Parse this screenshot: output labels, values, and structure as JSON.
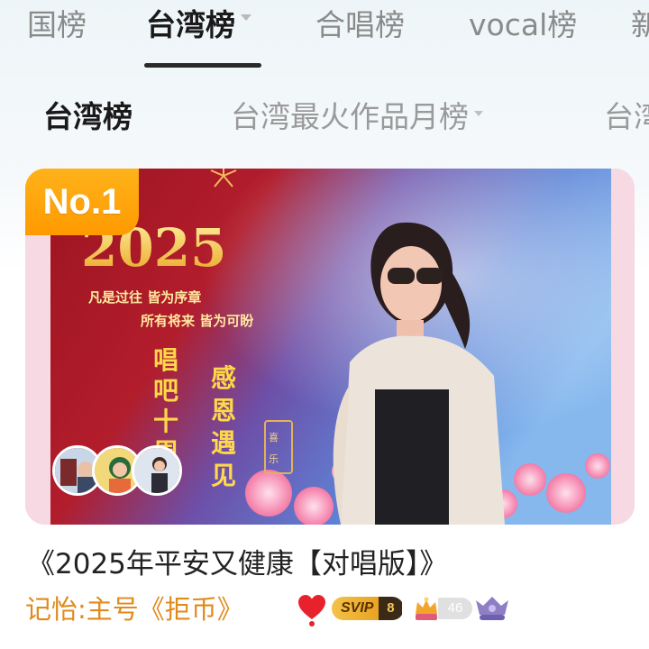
{
  "top_tabs": [
    {
      "label": "国榜"
    },
    {
      "label": "台湾榜",
      "active": true
    },
    {
      "label": "合唱榜"
    },
    {
      "label": "vocal榜"
    },
    {
      "label": "新"
    }
  ],
  "sub_tabs": [
    {
      "label": "台湾榜",
      "active": true
    },
    {
      "label": "台湾最火作品月榜"
    },
    {
      "label": "台湾"
    }
  ],
  "card": {
    "rank": "No.1",
    "cover_texts": {
      "year": "2025",
      "line1": "凡是过往 皆为序章",
      "line2": "所有将来 皆为可盼",
      "vertical_left": "唱吧十周",
      "vertical_right": "感恩遇见",
      "small_box": "喜乐"
    },
    "avatar_count": 3
  },
  "song": {
    "title": "《2025年平安又健康【对唱版】》",
    "author": "记怡:主号《拒币》",
    "svip_label": "SVIP",
    "svip_level": "8",
    "user_level": "46"
  },
  "colors": {
    "author": "#e08a1c",
    "rank_badge": "#ffa50a",
    "active_tab": "#1a1a1a",
    "inactive_tab": "#8a8a8a"
  }
}
